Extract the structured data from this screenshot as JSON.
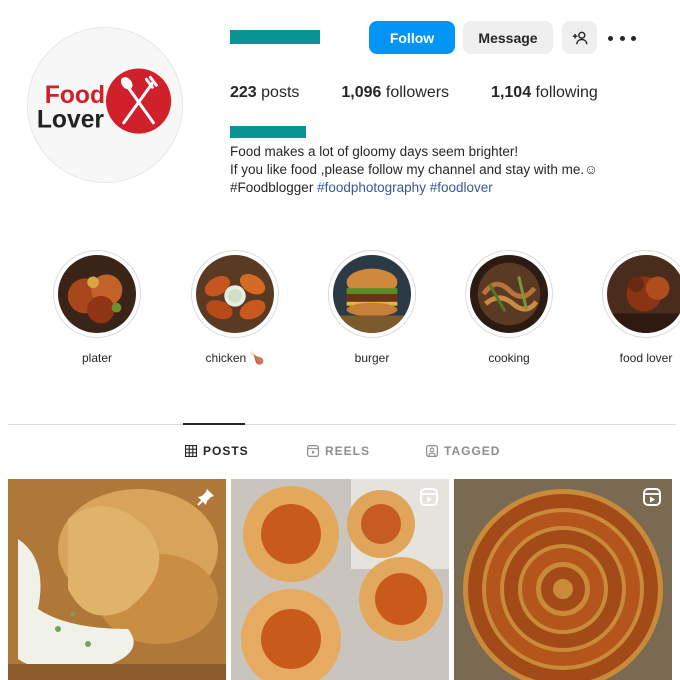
{
  "profile": {
    "logo_text_line1": "Food",
    "logo_text_line2": "Lover",
    "buttons": {
      "follow": "Follow",
      "message": "Message"
    },
    "stats": {
      "posts_count": "223",
      "posts_label": "posts",
      "followers_count": "1,096",
      "followers_label": "followers",
      "following_count": "1,104",
      "following_label": "following"
    },
    "bio": {
      "line1": "Food makes a lot of gloomy days seem brighter!",
      "line2": "If you like food ,please follow my channel and stay with me.☺",
      "hashtag1": "#Foodblogger",
      "hashtag2": "#foodphotography",
      "hashtag3": "#foodlover"
    }
  },
  "highlights": [
    {
      "label": "plater"
    },
    {
      "label": "chicken 🍗"
    },
    {
      "label": "burger"
    },
    {
      "label": "cooking"
    },
    {
      "label": "food lover"
    }
  ],
  "tabs": [
    {
      "label": "POSTS",
      "active": true,
      "icon": "grid-icon"
    },
    {
      "label": "REELS",
      "active": false,
      "icon": "reels-icon"
    },
    {
      "label": "TAGGED",
      "active": false,
      "icon": "tagged-icon"
    }
  ],
  "posts": [
    {
      "badge": "pin-icon"
    },
    {
      "badge": "reel-icon"
    },
    {
      "badge": "reel-icon"
    }
  ],
  "colors": {
    "accent": "#0095f6",
    "redacted": "#0a9395",
    "logo_red": "#d0202a"
  }
}
